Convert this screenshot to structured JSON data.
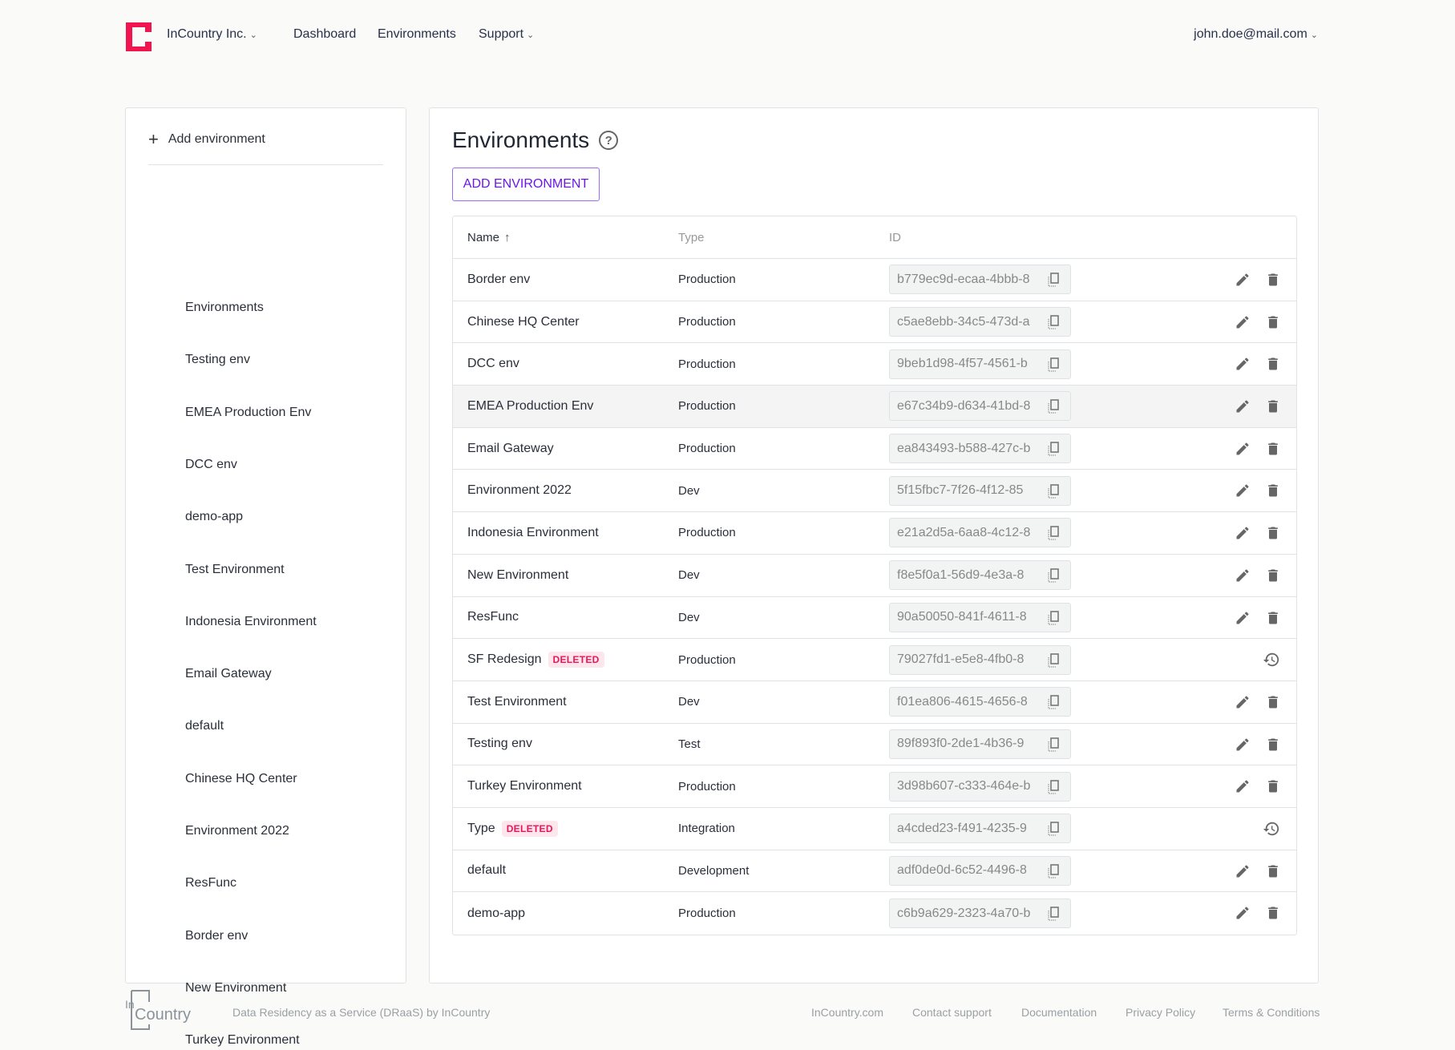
{
  "header": {
    "org": "InCountry Inc.",
    "nav": [
      "Dashboard",
      "Environments",
      "Support"
    ],
    "user": "john.doe@mail.com",
    "brand_color": "#f0144f"
  },
  "sidebar": {
    "add_label": "Add environment",
    "items": [
      "Environments",
      "Testing env",
      "EMEA Production Env",
      "DCC env",
      "demo-app",
      "Test Environment",
      "Indonesia Environment",
      "Email Gateway",
      "default",
      "Chinese HQ Center",
      "Environment 2022",
      "ResFunc",
      "Border env",
      "New Environment",
      "Turkey Environment"
    ]
  },
  "main": {
    "title": "Environments",
    "add_button": "ADD ENVIRONMENT",
    "columns": [
      "Name",
      "Type",
      "ID"
    ],
    "rows": [
      {
        "name": "Border env",
        "type": "Production",
        "id": "b779ec9d-ecaa-4bbb-8"
      },
      {
        "name": "Chinese HQ Center",
        "type": "Production",
        "id": "c5ae8ebb-34c5-473d-a"
      },
      {
        "name": "DCC env",
        "type": "Production",
        "id": "9beb1d98-4f57-4561-b"
      },
      {
        "name": "EMEA Production Env",
        "type": "Production",
        "id": "e67c34b9-d634-41bd-8"
      },
      {
        "name": "Email Gateway",
        "type": "Production",
        "id": "ea843493-b588-427c-b"
      },
      {
        "name": "Environment 2022",
        "type": "Dev",
        "id": "5f15fbc7-7f26-4f12-85"
      },
      {
        "name": "Indonesia Environment",
        "type": "Production",
        "id": "e21a2d5a-6aa8-4c12-8"
      },
      {
        "name": "New Environment",
        "type": "Dev",
        "id": "f8e5f0a1-56d9-4e3a-8"
      },
      {
        "name": "ResFunc",
        "type": "Dev",
        "id": "90a50050-841f-4611-8"
      },
      {
        "name": "SF Redesign",
        "badge": "DELETED",
        "type": "Production",
        "id": "79027fd1-e5e8-4fb0-8"
      },
      {
        "name": "Test Environment",
        "type": "Dev",
        "id": "f01ea806-4615-4656-8"
      },
      {
        "name": "Testing env",
        "type": "Test",
        "id": "89f893f0-2de1-4b36-9"
      },
      {
        "name": "Turkey Environment",
        "type": "Production",
        "id": "3d98b607-c333-464e-b"
      },
      {
        "name": "Type",
        "badge": "DELETED",
        "type": "Integration",
        "id": "a4cded23-f491-4235-9"
      },
      {
        "name": "default",
        "type": "Development",
        "id": "adf0de0d-6c52-4496-8"
      },
      {
        "name": "demo-app",
        "type": "Production",
        "id": "c6b9a629-2323-4a70-b"
      }
    ]
  },
  "footer": {
    "logo_text": "InCountry",
    "tagline": "Data Residency as a Service (DRaaS) by InCountry",
    "links": [
      "InCountry.com",
      "Contact support",
      "Documentation",
      "Privacy Policy",
      "Terms & Conditions"
    ]
  }
}
